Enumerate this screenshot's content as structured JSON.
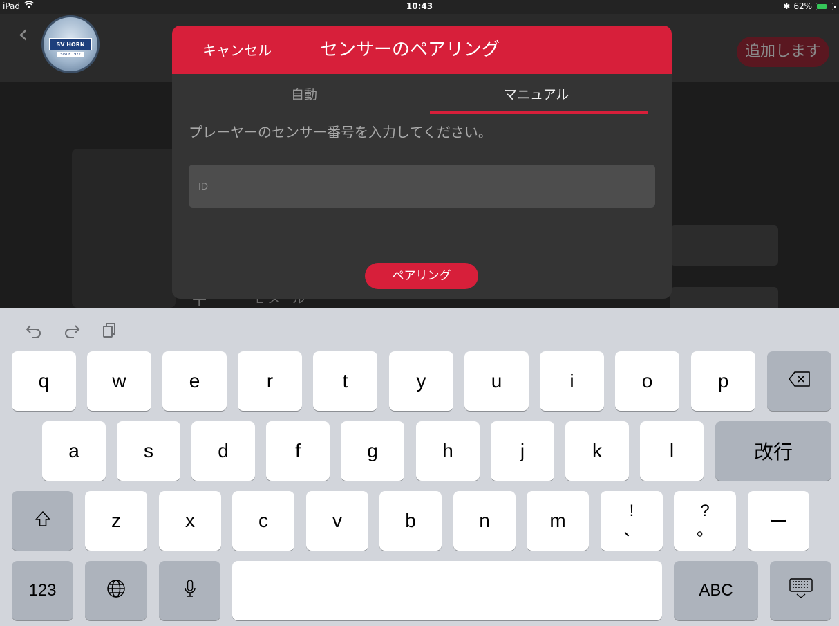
{
  "status_bar": {
    "device": "iPad",
    "time": "10:43",
    "bluetooth": "✱",
    "battery_percent": "62%",
    "battery_level": 0.62
  },
  "app_header": {
    "logo_text": "SV HORN",
    "logo_since": "SINCE 1922",
    "add_label": "追加します"
  },
  "background": {
    "plus": "+",
    "row_text": "E メール"
  },
  "modal": {
    "cancel_label": "キャンセル",
    "title": "センサーのペアリング",
    "tabs": [
      {
        "label": "自動",
        "active": false
      },
      {
        "label": "マニュアル",
        "active": true
      }
    ],
    "instruction": "プレーヤーのセンサー番号を入力してください。",
    "id_input": {
      "placeholder": "ID",
      "value": ""
    },
    "pair_label": "ペアリング"
  },
  "keyboard": {
    "row1": [
      "q",
      "w",
      "e",
      "r",
      "t",
      "y",
      "u",
      "i",
      "o",
      "p"
    ],
    "row2": [
      "a",
      "s",
      "d",
      "f",
      "g",
      "h",
      "j",
      "k",
      "l"
    ],
    "row3": [
      "z",
      "x",
      "c",
      "v",
      "b",
      "n",
      "m"
    ],
    "return_label": "改行",
    "exclaim_top": "!",
    "exclaim_bottom": "、",
    "question_top": "?",
    "question_bottom": "。",
    "dash": "ー",
    "numbers_label": "123",
    "abc_label": "ABC"
  },
  "colors": {
    "accent": "#d71f3a",
    "modal_bg": "#343434",
    "keyboard_bg": "#d2d5db"
  }
}
